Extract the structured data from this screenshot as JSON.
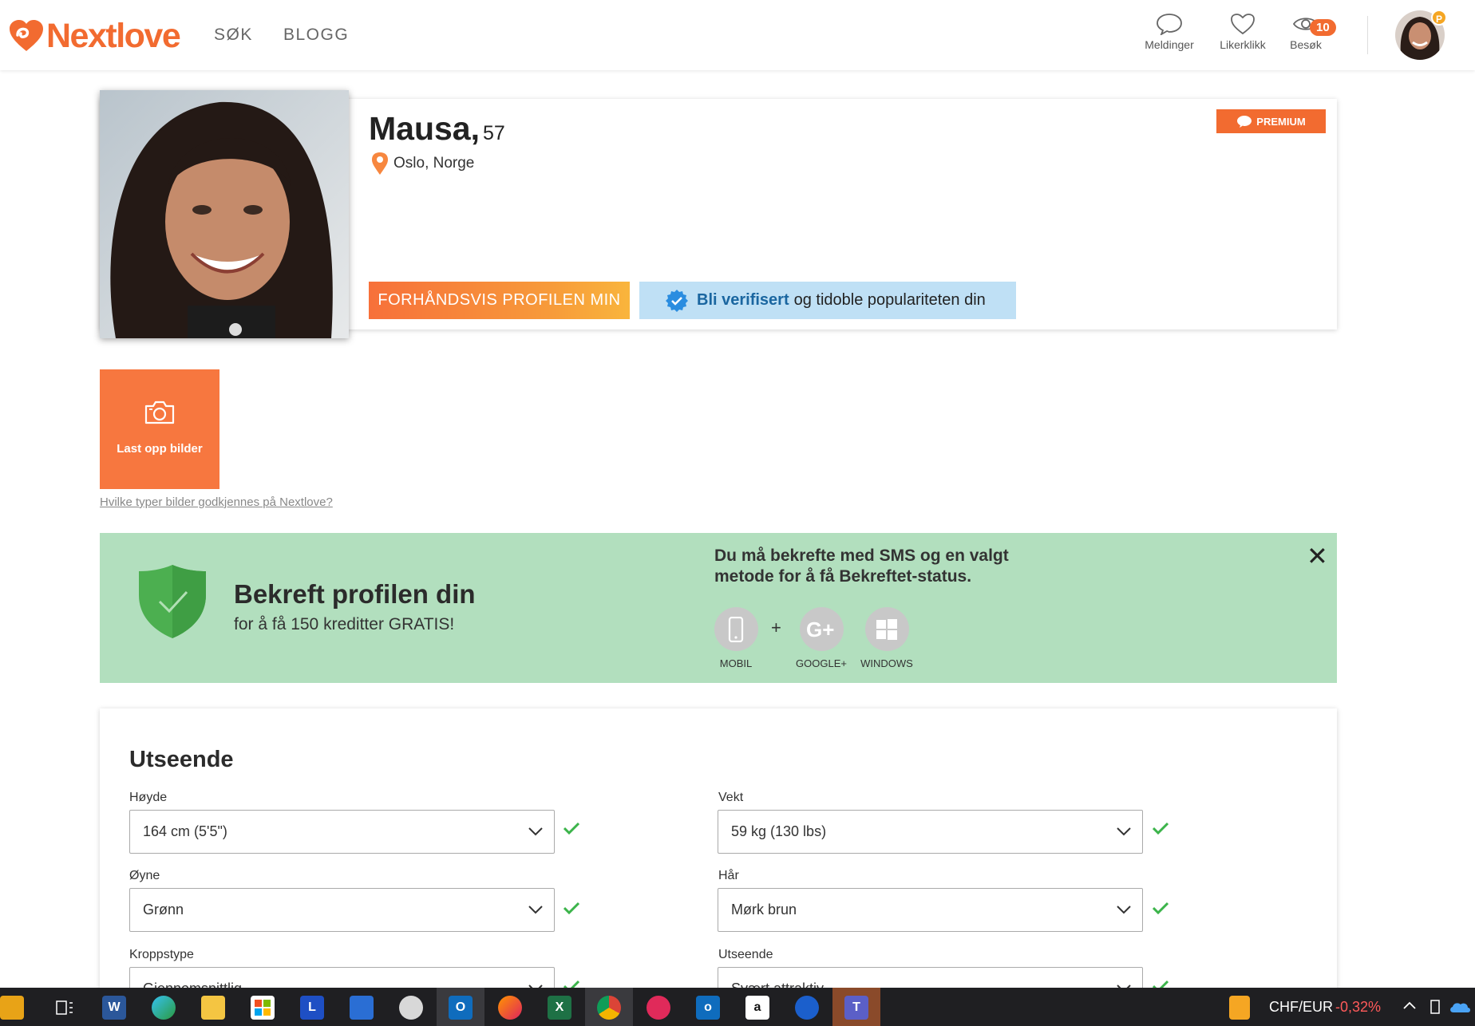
{
  "header": {
    "logo_text": "Nextlove",
    "nav": {
      "sok": "SØK",
      "blogg": "BLOGG"
    },
    "meldinger": "Meldinger",
    "likerklikk": "Likerklikk",
    "besok": "Besøk",
    "besok_count": "10",
    "avatar_badge": "P",
    "brand_color": "#f26b30"
  },
  "profile": {
    "name": "Mausa,",
    "age": "57",
    "location": "Oslo, Norge",
    "premium": "PREMIUM",
    "preview_button": "FORHÅNDSVIS PROFILEN MIN",
    "verify_bold": "Bli verifisert",
    "verify_rest": "og tidoble populariteten din"
  },
  "upload": {
    "label": "Last opp bilder",
    "help_link": "Hvilke typer bilder godkjennes på Nextlove?"
  },
  "verify_banner": {
    "title": "Bekreft profilen din",
    "subtitle": "for å få 150 kreditter GRATIS!",
    "text": "Du må bekrefte med SMS og en valgt metode for å få Bekreftet-status.",
    "plus": "+",
    "close": "✕",
    "methods": [
      {
        "label": "MOBIL",
        "icon": "phone-icon"
      },
      {
        "label": "GOOGLE+",
        "icon": "google-plus-icon"
      },
      {
        "label": "WINDOWS",
        "icon": "windows-icon"
      }
    ],
    "bg_color": "#b2dfbe"
  },
  "appearance": {
    "title": "Utseende",
    "fields": [
      {
        "label": "Høyde",
        "value": "164 cm (5'5\")"
      },
      {
        "label": "Vekt",
        "value": "59 kg (130 lbs)"
      },
      {
        "label": "Øyne",
        "value": "Grønn"
      },
      {
        "label": "Hår",
        "value": "Mørk brun"
      },
      {
        "label": "Kroppstype",
        "value": "Gjennomsnittlig"
      },
      {
        "label": "Utseende",
        "value": "Svært attraktiv"
      }
    ]
  },
  "taskbar": {
    "apps": [
      "file-explorer",
      "task-view",
      "word",
      "edge",
      "explorer",
      "store",
      "L",
      "app",
      "app",
      "outlook",
      "firefox",
      "excel",
      "chrome",
      "app",
      "outlook",
      "amazon",
      "app",
      "teams"
    ],
    "ticker": "CHF/EUR",
    "ticker_change": "-0,32%"
  }
}
